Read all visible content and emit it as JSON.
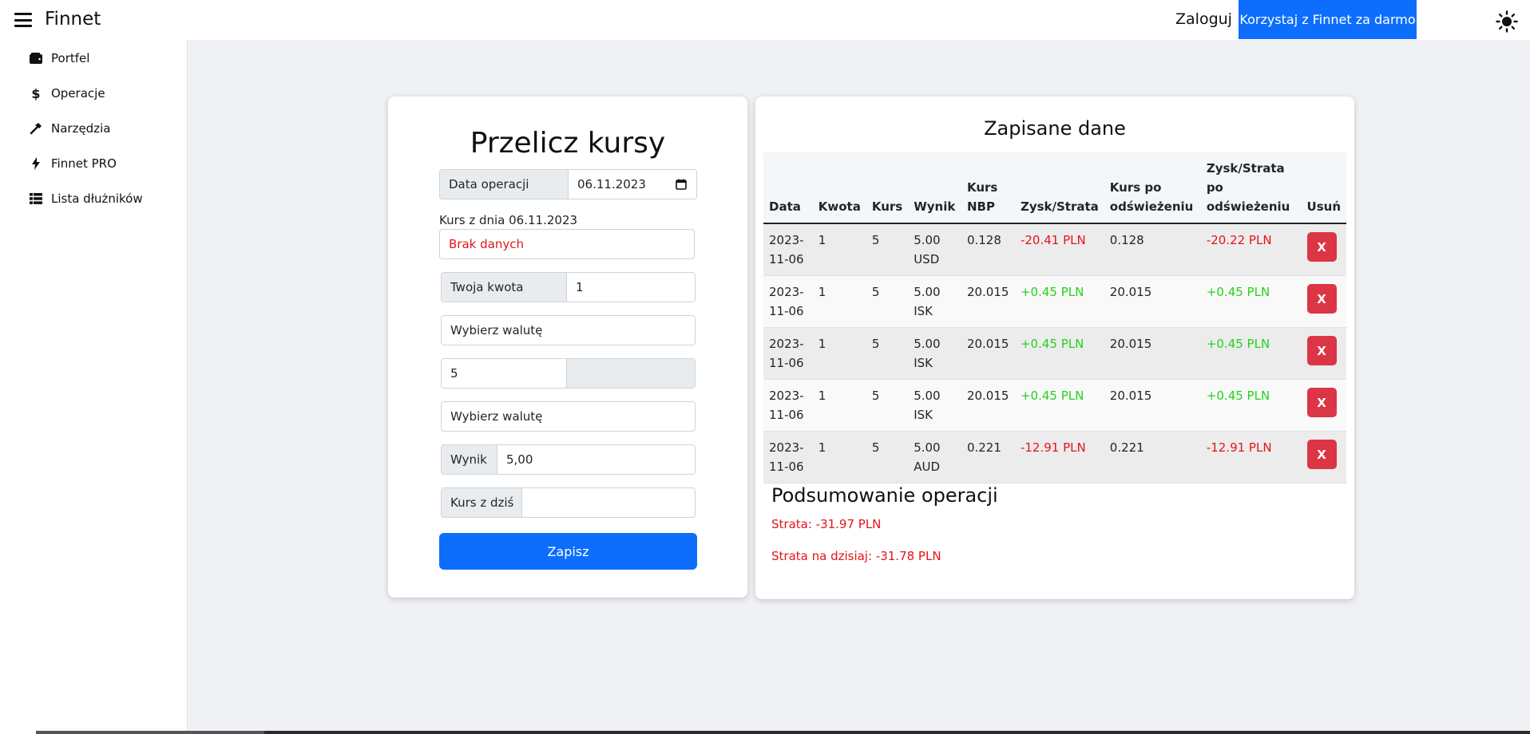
{
  "header": {
    "brand": "Finnet",
    "login": "Zaloguj",
    "cta": "Korzystaj z Finnet za darmo",
    "accent_color": "#0d6efd"
  },
  "sidebar": {
    "items": [
      {
        "label": "Portfel",
        "icon": "wallet-icon"
      },
      {
        "label": "Operacje",
        "icon": "dollar-icon"
      },
      {
        "label": "Narzędzia",
        "icon": "hammer-icon"
      },
      {
        "label": "Finnet PRO",
        "icon": "lightning-icon"
      },
      {
        "label": "Lista dłużników",
        "icon": "list-icon"
      }
    ]
  },
  "converter": {
    "title": "Przelicz kursy",
    "date_label": "Data operacji",
    "date_value": "06.11.2023",
    "rate_caption": "Kurs z dnia 06.11.2023",
    "rate_value": "Brak danych",
    "amount_label": "Twoja kwota",
    "amount_value": "1",
    "currency_select_1": "Wybierz walutę",
    "rate_input": "5",
    "rate_input_right": "",
    "currency_select_2": "Wybierz walutę",
    "result_label": "Wynik",
    "result_value": "5,00",
    "today_label": "Kurs z dziś",
    "today_value": "",
    "save_label": "Zapisz"
  },
  "saved": {
    "title": "Zapisane dane",
    "columns": [
      "Data",
      "Kwota",
      "Kurs",
      "Wynik",
      "Kurs NBP",
      "Zysk/Strata",
      "Kurs po odświeżeniu",
      "Zysk/Strata po odświeżeniu",
      "Usuń"
    ],
    "rows": [
      {
        "date": "2023-11-06",
        "amount": "1",
        "rate": "5",
        "result": "5.00 USD",
        "nbp": "0.128",
        "pl": "-20.41 PLN",
        "refreshed": "0.128",
        "pl_refreshed": "-20.22 PLN",
        "delete": "X",
        "sign": "neg"
      },
      {
        "date": "2023-11-06",
        "amount": "1",
        "rate": "5",
        "result": "5.00 ISK",
        "nbp": "20.015",
        "pl": "+0.45 PLN",
        "refreshed": "20.015",
        "pl_refreshed": "+0.45 PLN",
        "delete": "X",
        "sign": "pos"
      },
      {
        "date": "2023-11-06",
        "amount": "1",
        "rate": "5",
        "result": "5.00 ISK",
        "nbp": "20.015",
        "pl": "+0.45 PLN",
        "refreshed": "20.015",
        "pl_refreshed": "+0.45 PLN",
        "delete": "X",
        "sign": "pos"
      },
      {
        "date": "2023-11-06",
        "amount": "1",
        "rate": "5",
        "result": "5.00 ISK",
        "nbp": "20.015",
        "pl": "+0.45 PLN",
        "refreshed": "20.015",
        "pl_refreshed": "+0.45 PLN",
        "delete": "X",
        "sign": "pos"
      },
      {
        "date": "2023-11-06",
        "amount": "1",
        "rate": "5",
        "result": "5.00 AUD",
        "nbp": "0.221",
        "pl": "-12.91 PLN",
        "refreshed": "0.221",
        "pl_refreshed": "-12.91 PLN",
        "delete": "X",
        "sign": "neg"
      }
    ]
  },
  "summary": {
    "title": "Podsumowanie operacji",
    "loss": "Strata: -31.97 PLN",
    "loss_today": "Strata na dzisiaj: -31.78 PLN",
    "negative_color": "#e3151a",
    "positive_color": "#22d31b",
    "delete_color": "#dc3545"
  }
}
